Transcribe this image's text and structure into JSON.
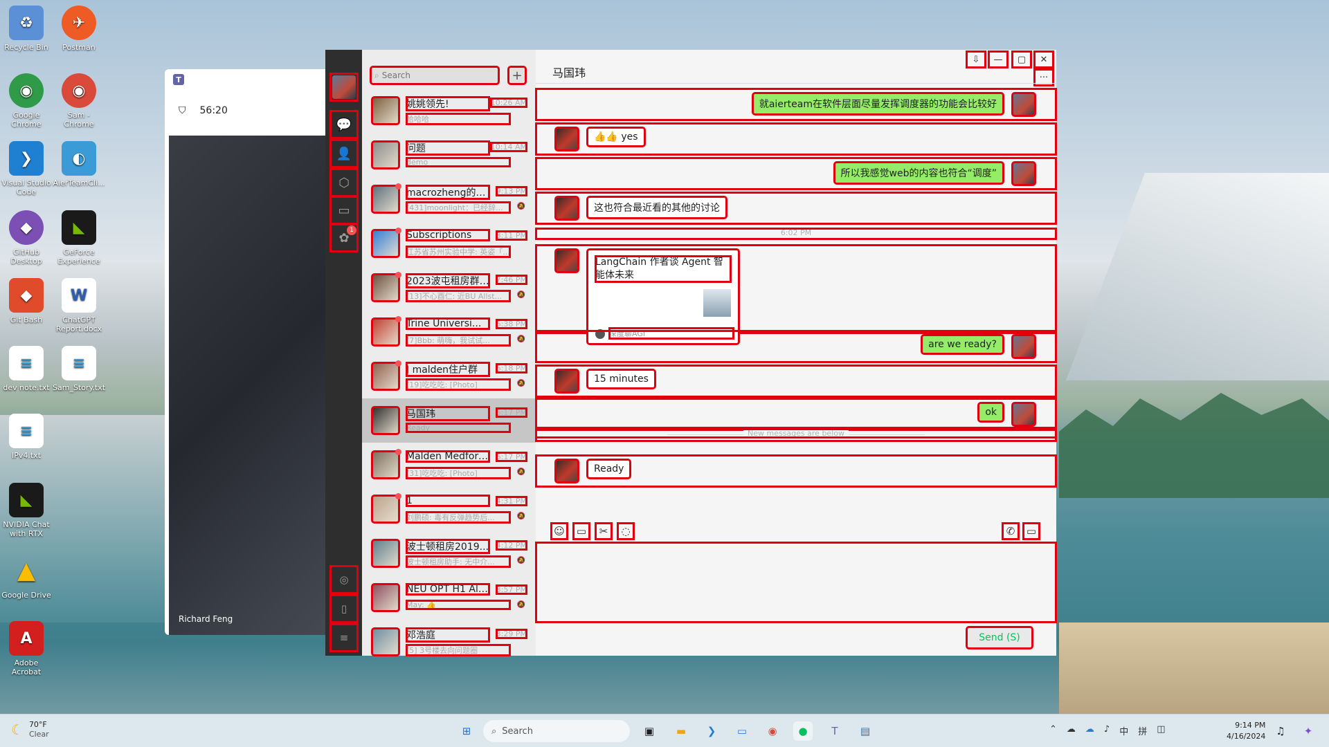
{
  "desktop": {
    "icons": [
      {
        "label": "Recycle Bin",
        "glyph": "♻",
        "color": "#5b8fd6"
      },
      {
        "label": "Postman",
        "glyph": "✈",
        "color": "#ef5b25"
      },
      {
        "label": "Google Chrome",
        "glyph": "◉",
        "color": "#2f9a48"
      },
      {
        "label": "Sam - Chrome",
        "glyph": "◉",
        "color": "#d94a3a"
      },
      {
        "label": "Visual Studio Code",
        "glyph": "❯",
        "color": "#1f7fd1"
      },
      {
        "label": "AierTeamCli...",
        "glyph": "◐",
        "color": "#3a9bd6"
      },
      {
        "label": "GitHub Desktop",
        "glyph": "◆",
        "color": "#7b4fb3"
      },
      {
        "label": "GeForce Experience",
        "glyph": "◣",
        "color": "#76b900"
      },
      {
        "label": "Git Bash",
        "glyph": "◆",
        "color": "#e04b2c"
      },
      {
        "label": "ChatGPT Report.docx",
        "glyph": "W",
        "color": "#2b5fb3"
      },
      {
        "label": "dev note.txt",
        "glyph": "≡",
        "color": "#ffffff"
      },
      {
        "label": "Sam_Story.txt",
        "glyph": "≡",
        "color": "#ffffff"
      },
      {
        "label": "IPv4.txt",
        "glyph": "≡",
        "color": "#ffffff"
      },
      {
        "label": "NVIDIA Chat with RTX",
        "glyph": "◣",
        "color": "#76b900"
      },
      {
        "label": "Google Drive",
        "glyph": "▲",
        "color": "#1fa463"
      },
      {
        "label": "Adobe Acrobat",
        "glyph": "A",
        "color": "#d3201f"
      }
    ]
  },
  "teams": {
    "app_glyph": "T",
    "timer": "56:20",
    "shield_icon": "shield-icon",
    "participant_name": "Richard Feng"
  },
  "wechat": {
    "sidebar": {
      "badge_count": "1",
      "items": [
        "chat-icon",
        "contacts-icon",
        "favorites-icon",
        "files-icon",
        "moments-icon",
        "mini-programs-icon",
        "phone-icon",
        "menu-icon"
      ]
    },
    "search": {
      "placeholder": "Search"
    },
    "plus_label": "+",
    "chats": [
      {
        "name": "姚姚领先!",
        "time": "10:26 AM",
        "preview": "哈哈哈",
        "dot": false,
        "muted": false,
        "color": "#7a5a3a"
      },
      {
        "name": "问题",
        "time": "10:14 AM",
        "preview": "demo",
        "dot": false,
        "muted": false,
        "color": "#888888"
      },
      {
        "name": "macrozheng的技...",
        "time": "9:13 PM",
        "preview": "[431]moonlight：已经辞...",
        "dot": true,
        "muted": true,
        "color": "#5a6b7a"
      },
      {
        "name": "Subscriptions",
        "time": "8:11 PM",
        "preview": "江苏省苏州实验中学: 英姿「...",
        "dot": true,
        "muted": false,
        "color": "#2b7bd6"
      },
      {
        "name": "2023波屯租房群1...",
        "time": "7:46 PM",
        "preview": "[13]不心酉仁: 近BU Allst...",
        "dot": true,
        "muted": true,
        "color": "#6a4a3a"
      },
      {
        "name": "Trine Universi...",
        "time": "6:38 PM",
        "preview": "[7]Bbb: 萌嗨，我试试...",
        "dot": true,
        "muted": true,
        "color": "#c0392b"
      },
      {
        "name": "J malden住户群",
        "time": "6:18 PM",
        "preview": "[19]吃吃吃: [Photo]",
        "dot": true,
        "muted": true,
        "color": "#8e5a4a"
      },
      {
        "name": "马国玮",
        "time": "6:17 PM",
        "preview": "Ready",
        "dot": false,
        "muted": false,
        "color": "#2a2a2a"
      },
      {
        "name": "Malden Medford...",
        "time": "6:17 PM",
        "preview": "[31]吃吃吃: [Photo]",
        "dot": true,
        "muted": true,
        "color": "#7a6a5a"
      },
      {
        "name": "1",
        "time": "4:31 PM",
        "preview": "刘鹏硕: 毒有反弹趋势后...",
        "dot": true,
        "muted": true,
        "color": "#b9a08a"
      },
      {
        "name": "波士顿租房2019...",
        "time": "4:12 PM",
        "preview": "波士顿租房助手: 无中介...",
        "dot": false,
        "muted": true,
        "color": "#5a7a8a"
      },
      {
        "name": "NEU OPT H1 Alu...",
        "time": "3:57 PM",
        "preview": "May: 👍",
        "dot": false,
        "muted": true,
        "color": "#8a4a5a"
      },
      {
        "name": "邓浩庭",
        "time": "3:29 PM",
        "preview": "[5] 3号楼去向问题圈",
        "dot": false,
        "muted": false,
        "color": "#6a8aa0"
      }
    ],
    "chat": {
      "title": "马国玮",
      "window_buttons": [
        "pin-icon",
        "minimize-icon",
        "maximize-icon",
        "close-icon"
      ],
      "more_label": "···",
      "messages": [
        {
          "side": "me",
          "text": "就aierteam在软件层面尽量发挥调度器的功能会比较好"
        },
        {
          "side": "them",
          "text": "👍👍 yes"
        },
        {
          "side": "me",
          "text": "所以我感觉web的内容也符合“调度”"
        },
        {
          "side": "them",
          "text": "这也符合最近看的其他的讨论"
        },
        {
          "side": "time",
          "text": "6:02 PM"
        },
        {
          "side": "card",
          "title": "LangChain 作者谈 Agent 智能体未来",
          "source": "深度聊AGI"
        },
        {
          "side": "me",
          "text": "are we ready?"
        },
        {
          "side": "them",
          "text": "15 minutes"
        },
        {
          "side": "me",
          "text": "ok"
        },
        {
          "side": "divider",
          "text": "New messages are below"
        },
        {
          "side": "them",
          "text": "Ready"
        }
      ],
      "toolbar": [
        "emoji-icon",
        "folder-icon",
        "scissors-icon",
        "chat-history-icon",
        "voice-call-icon",
        "video-call-icon"
      ],
      "send_label": "Send (S)"
    }
  },
  "taskbar": {
    "weather_temp": "70°F",
    "weather_desc": "Clear",
    "search_placeholder": "Search",
    "time": "9:14 PM",
    "date": "4/16/2024",
    "ime": "中",
    "ime2": "拼"
  }
}
